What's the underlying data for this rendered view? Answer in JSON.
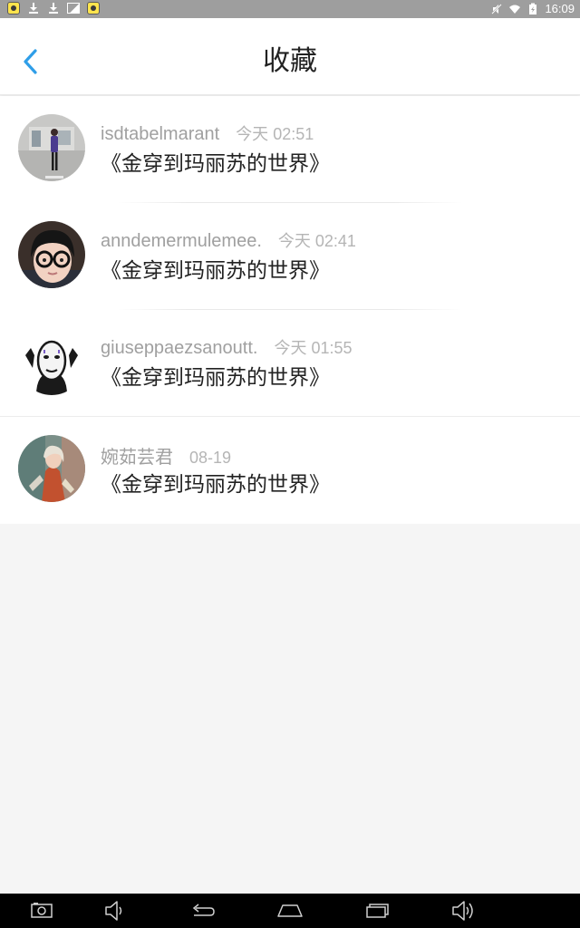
{
  "status_bar": {
    "time": "16:09",
    "left_icons": [
      "app-icon",
      "download-icon",
      "download-icon",
      "image-icon",
      "app-icon"
    ],
    "right_icons": [
      "mute-icon",
      "wifi-icon",
      "battery-charging-icon"
    ]
  },
  "header": {
    "title": "收藏",
    "back_icon": "chevron-left-icon",
    "accent_color": "#2f9ee8"
  },
  "favorites": [
    {
      "username": "isdtabelmarant",
      "time": "今天 02:51",
      "title": "《金穿到玛丽苏的世界》"
    },
    {
      "username": "anndemermulemee.",
      "time": "今天 02:41",
      "title": "《金穿到玛丽苏的世界》"
    },
    {
      "username": "giuseppaezsanoutt.",
      "time": "今天 01:55",
      "title": "《金穿到玛丽苏的世界》"
    },
    {
      "username": "婉茹芸君",
      "time": "08-19",
      "title": "《金穿到玛丽苏的世界》"
    }
  ],
  "nav_bar": {
    "icons": [
      "screenshot-icon",
      "volume-down-icon",
      "back-icon",
      "home-icon",
      "recent-apps-icon",
      "volume-up-icon"
    ]
  }
}
